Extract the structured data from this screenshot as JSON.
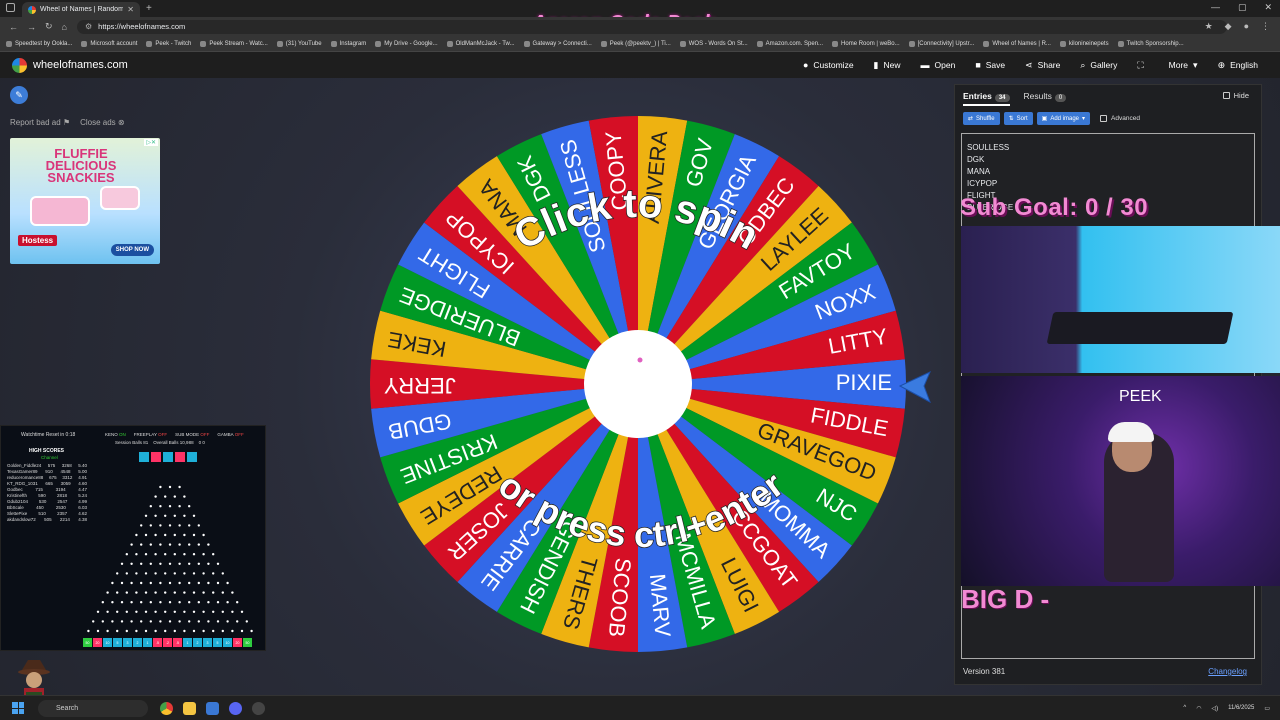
{
  "browser": {
    "tab_title": "Wheel of Names | Random name",
    "url": "https://wheelofnames.com",
    "bookmarks": [
      "Speedtest by Ookla...",
      "Microsoft account",
      "Peek - Twitch",
      "Peek Stream - Watc...",
      "(31) YouTube",
      "Instagram",
      "My Drive - Google...",
      "OldManMcJack - Tw...",
      "Gateway > Connecti...",
      "Peek (@peektv_) | Ti...",
      "WOS - Words On St...",
      "Amazon.com. Spen...",
      "Home Room | weBo...",
      "[Connectivity] Upstr...",
      "Wheel of Names | R...",
      "kilonineinepets",
      "Twitch Sponsorship..."
    ]
  },
  "stream": {
    "title": "Azeron Code Peek",
    "sub_goal": "Sub Goal:  0 / 30",
    "cam_label": "PEEK",
    "big_text": "BIG D -"
  },
  "app": {
    "site_name": "wheelofnames.com",
    "menu": [
      {
        "label": "Customize",
        "icon": "palette-icon",
        "glyph": "●"
      },
      {
        "label": "New",
        "icon": "new-file-icon",
        "glyph": "▮"
      },
      {
        "label": "Open",
        "icon": "folder-icon",
        "glyph": "▬"
      },
      {
        "label": "Save",
        "icon": "save-icon",
        "glyph": "■"
      },
      {
        "label": "Share",
        "icon": "share-icon",
        "glyph": "⋖"
      },
      {
        "label": "Gallery",
        "icon": "search-icon",
        "glyph": "⌕"
      },
      {
        "label": "",
        "icon": "fullscreen-icon",
        "glyph": "⛶"
      },
      {
        "label": "More",
        "icon": "chevron-down-icon",
        "glyph": "▾"
      },
      {
        "label": "English",
        "icon": "globe-icon",
        "glyph": "⊕"
      }
    ]
  },
  "ads": {
    "report": "Report bad ad",
    "close": "Close ads",
    "headline": "FLUFFIE DELICIOUS SNACKIES",
    "brand": "Hostess",
    "cta": "SHOP NOW"
  },
  "wheel": {
    "text_top": "Click to spin",
    "text_bottom": "or press ctrl+enter",
    "colors": [
      "#3369e8",
      "#d50f25",
      "#eeb211",
      "#009925"
    ],
    "segments": [
      "PIXIE",
      "FIDDLE",
      "GRAVEGOD",
      "NJC",
      "MOMMA",
      "CCGOAT",
      "LUIGI",
      "MCMILLA",
      "MARV",
      "SCOOB",
      "THERS",
      "GENDISH",
      "CARRIE",
      "JOSER",
      "REDEYE",
      "KRISTINE",
      "GDUB",
      "JERRY",
      "KEKE",
      "BLUERIDGE",
      "FLIGHT",
      "ICYPOP",
      "MANA",
      "DGK",
      "SOULLESS",
      "COOPY",
      "ALIVERA",
      "GOV",
      "GEORGIA",
      "ODBEC",
      "LAYLEE",
      "FAVTOY",
      "NOXX",
      "LITTY"
    ]
  },
  "panel": {
    "tab_entries": "Entries",
    "entries_count": "34",
    "tab_results": "Results",
    "results_count": "0",
    "hide": "Hide",
    "shuffle": "Shuffle",
    "sort": "Sort",
    "add_image": "Add image",
    "advanced": "Advanced",
    "entries": [
      "SOULLESS",
      "DGK",
      "MANA",
      "ICYPOP",
      "FLIGHT",
      "BLUERIDGE"
    ],
    "version": "Version 381",
    "changelog": "Changelog"
  },
  "game": {
    "watchtime": "Watchtime Reset in 0:18",
    "modes": [
      {
        "label": "KENO",
        "state": "ON"
      },
      {
        "label": "FREEPLAY",
        "state": "OFF"
      },
      {
        "label": "SUB MODE",
        "state": "OFF"
      },
      {
        "label": "GAMBA",
        "state": "OFF"
      }
    ],
    "session_balls": "Session Balls 81",
    "overall_balls": "Overall Balls 10,988",
    "extra": "0   0",
    "hs_title": "HIGH SCORES",
    "hs_sub": "Channel",
    "scores": [
      [
        "Golden_Fiddle24",
        "575",
        "3268",
        "5.40"
      ],
      [
        "TexasGamer89",
        "910",
        "4548",
        "5.00"
      ],
      [
        "reduceromance88",
        "675",
        "3312",
        "4.91"
      ],
      [
        "KT_RDG_1031",
        "665",
        "3059",
        "4.60"
      ],
      [
        "Godbec",
        "715",
        "3194",
        "4.47"
      ],
      [
        "Kristinefth",
        "590",
        "2818",
        "5.24"
      ],
      [
        "Gdub2104",
        "530",
        "2547",
        "4.99"
      ],
      [
        "BbScale",
        "450",
        "2530",
        "6.03"
      ],
      [
        "SlettePixe",
        "510",
        "2357",
        "4.62"
      ],
      [
        "akdandslow72",
        "505",
        "2214",
        "4.38"
      ]
    ],
    "multipliers": [
      "",
      "",
      "",
      "",
      ""
    ],
    "bins": [
      "50",
      "20",
      "10",
      "5",
      "3",
      "2",
      "1",
      ".5",
      ".2",
      ".5",
      "1",
      "2",
      "3",
      "5",
      "10",
      "20",
      "50"
    ],
    "bin_colors": [
      "#2ecc40",
      "#ff3366",
      "#1fb0d8",
      "#1fb0d8",
      "#1fb0d8",
      "#1fb0d8",
      "#1fb0d8",
      "#ff3366",
      "#ff3366",
      "#ff3366",
      "#1fb0d8",
      "#1fb0d8",
      "#1fb0d8",
      "#1fb0d8",
      "#1fb0d8",
      "#ff3366",
      "#2ecc40"
    ],
    "mult_colors": [
      "#1fb0d8",
      "#ff3366",
      "#1fb0d8",
      "#ff3366",
      "#1fb0d8"
    ]
  },
  "taskbar": {
    "search": "Search",
    "time": "",
    "date": "11/6/2025"
  }
}
